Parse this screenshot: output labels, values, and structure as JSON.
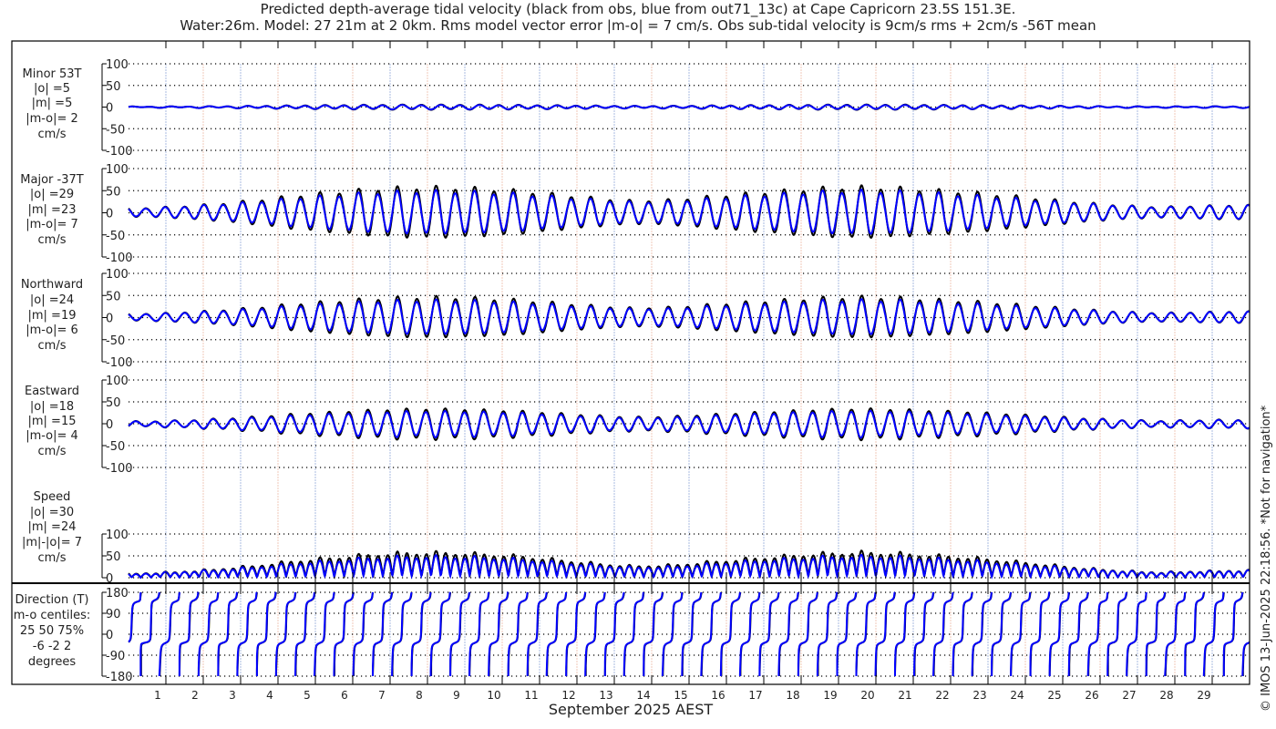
{
  "title": {
    "line1": "Predicted depth-average tidal velocity (black from obs, blue from out71_13c) at Cape Capricorn 23.5S 151.3E.",
    "line2": "Water:26m. Model: 27 21m at 2 0km. Rms model vector error |m-o| = 7 cm/s. Obs sub-tidal velocity is 9cm/s rms + 2cm/s -56T mean"
  },
  "footer": {
    "xlabel": "September 2025 AEST",
    "copyright": "© IMOS 13-Jun-2025 22:18:56. *Not for navigation*"
  },
  "colors": {
    "obs": "#000000",
    "model": "#0000ff",
    "grid_a": "#aabbe0",
    "grid_b": "#f0c8b8"
  },
  "chart_data": {
    "type": "line",
    "x_unit": "day of September 2025 (AEST)",
    "x_ticks": [
      "1",
      "2",
      "3",
      "4",
      "5",
      "6",
      "7",
      "8",
      "9",
      "10",
      "11",
      "12",
      "13",
      "14",
      "15",
      "16",
      "17",
      "18",
      "19",
      "20",
      "21",
      "22",
      "23",
      "24",
      "25",
      "26",
      "27",
      "28",
      "29"
    ],
    "tide_period_hours": 12.42,
    "major_axis_direction_T": -37,
    "daily_major_amplitude_obs": [
      10,
      14,
      20,
      28,
      38,
      45,
      52,
      56,
      56,
      53,
      48,
      40,
      32,
      26,
      28,
      35,
      42,
      48,
      54,
      57,
      55,
      50,
      45,
      38,
      30,
      22,
      16,
      12,
      14,
      16
    ],
    "daily_major_amplitude_model": [
      9,
      13,
      18,
      24,
      32,
      38,
      44,
      47,
      47,
      45,
      41,
      34,
      28,
      23,
      24,
      30,
      36,
      41,
      46,
      48,
      47,
      43,
      38,
      32,
      26,
      20,
      15,
      11,
      13,
      15
    ],
    "minor_to_major_ratio": 0.2,
    "panels": [
      {
        "key": "minor",
        "label": [
          "Minor 53T",
          "|o| =5",
          "|m| =5",
          "|m-o|= 2",
          "cm/s"
        ],
        "yticks": [
          "100",
          "50",
          "0",
          "-50",
          "-100"
        ],
        "ylim": [
          -100,
          100
        ]
      },
      {
        "key": "major",
        "label": [
          "Major -37T",
          "|o| =29",
          "|m| =23",
          "|m-o|= 7",
          "cm/s"
        ],
        "yticks": [
          "100",
          "50",
          "0",
          "-50",
          "-100"
        ],
        "ylim": [
          -100,
          100
        ]
      },
      {
        "key": "north",
        "label": [
          "Northward",
          "|o| =24",
          "|m| =19",
          "|m-o|= 6",
          "cm/s"
        ],
        "yticks": [
          "100",
          "50",
          "0",
          "-50",
          "-100"
        ],
        "ylim": [
          -100,
          100
        ]
      },
      {
        "key": "east",
        "label": [
          "Eastward",
          "|o| =18",
          "|m| =15",
          "|m-o|= 4",
          "cm/s"
        ],
        "yticks": [
          "100",
          "50",
          "0",
          "-50",
          "-100"
        ],
        "ylim": [
          -100,
          100
        ]
      },
      {
        "key": "speed",
        "label": [
          "Speed",
          "|o| =30",
          "|m| =24",
          "|m|-|o|= 7",
          "cm/s"
        ],
        "yticks": [
          "100",
          "50",
          "0"
        ],
        "ylim": [
          0,
          100
        ]
      },
      {
        "key": "direction",
        "label": [
          "Direction (T)",
          "m-o centiles:",
          "25  50  75%",
          "-6 -2  2",
          "degrees"
        ],
        "yticks": [
          "180",
          "90",
          "0",
          "-90",
          "-180"
        ],
        "ylim": [
          -180,
          180
        ]
      }
    ]
  }
}
